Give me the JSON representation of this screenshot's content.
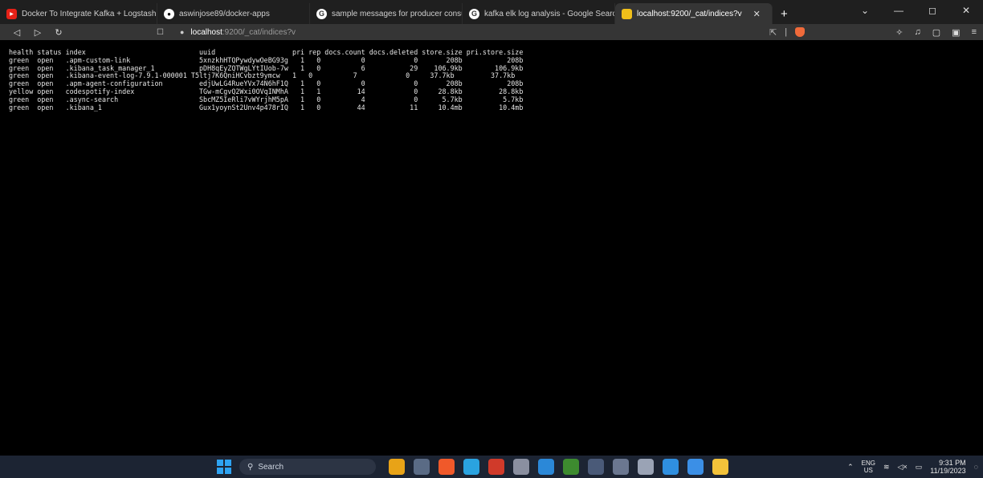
{
  "tabs": [
    {
      "title": "Docker To Integrate Kafka + Logstash",
      "icon": "youtube-icon",
      "color": "#e62117"
    },
    {
      "title": "aswinjose89/docker-apps",
      "icon": "github-icon",
      "color": "#ffffff"
    },
    {
      "title": "sample messages for producer consu",
      "icon": "google-icon",
      "color": "#ffffff"
    },
    {
      "title": "kafka elk log analysis - Google Search",
      "icon": "google-icon",
      "color": "#ffffff"
    },
    {
      "title": "localhost:9200/_cat/indices?v",
      "icon": "elasticsearch-icon",
      "color": "#f0bf1a",
      "active": true
    }
  ],
  "address": {
    "host": "localhost",
    "path": ":9200/_cat/indices?v"
  },
  "cat_output": {
    "header": "health status index                            uuid                   pri rep docs.count docs.deleted store.size pri.store.size",
    "rows": [
      "green  open   .apm-custom-link                 5xnzkhHTQPywdywOeBG93g   1   0          0            0       208b           208b",
      "green  open   .kibana_task_manager_1           pDH8qEyZQTWgLYtIUob-7w   1   0          6           29    106.9kb        106.9kb",
      "green  open   .kibana-event-log-7.9.1-000001 T5ltj7K6QniHCvbzt9ymcw   1   0          7            0     37.7kb         37.7kb",
      "green  open   .apm-agent-configuration         edjUwLG4RueYVx74N6hF1Q   1   0          0            0       208b           208b",
      "yellow open   codespotify-index                TGw-mCgvQ2Wxi0OVqINMhA   1   1         14            0     28.8kb         28.8kb",
      "green  open   .async-search                    SbcMZ5IeRli7vWYrjhM5pA   1   0          4            0      5.7kb          5.7kb",
      "green  open   .kibana_1                        Gux1yoynSt2Unv4p478rIQ   1   0         44           11     10.4mb         10.4mb"
    ]
  },
  "taskbar": {
    "search_label": "Search",
    "apps": [
      {
        "name": "fruits-app-icon",
        "color": "#e8a317"
      },
      {
        "name": "notepad-icon",
        "color": "#5a6b85"
      },
      {
        "name": "brave-icon",
        "color": "#f0592a"
      },
      {
        "name": "telegram-icon",
        "color": "#2aa3e0"
      },
      {
        "name": "chrome-icon",
        "color": "#d03a2a"
      },
      {
        "name": "vpn-icon",
        "color": "#8a8fa0"
      },
      {
        "name": "mail-icon",
        "color": "#2b88d8"
      },
      {
        "name": "nvidia-icon",
        "color": "#3d8b2f"
      },
      {
        "name": "calculator-icon",
        "color": "#4a5a78"
      },
      {
        "name": "speedometer-icon",
        "color": "#6b7790"
      },
      {
        "name": "settings-icon",
        "color": "#9aa3b5"
      },
      {
        "name": "vscode-icon",
        "color": "#2f8fe0"
      },
      {
        "name": "monitor-icon",
        "color": "#3b8fe6"
      },
      {
        "name": "folder-icon",
        "color": "#f2c23a"
      }
    ],
    "lang_top": "ENG",
    "lang_bottom": "US",
    "time": "9:31 PM",
    "date": "11/19/2023"
  }
}
